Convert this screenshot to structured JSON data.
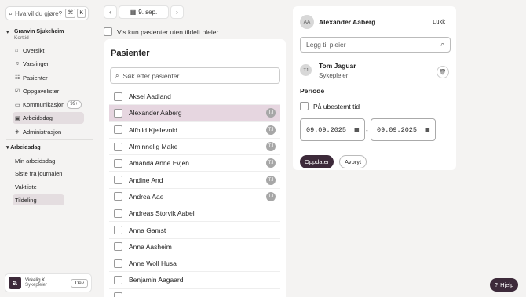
{
  "sidebar": {
    "search": {
      "placeholder": "Hva vil du gjøre?",
      "kbd1": "⌘",
      "kbd2": "K"
    },
    "org": {
      "name": "Granvin Sjukeheim",
      "sub": "Korttid"
    },
    "nav": [
      {
        "icon": "home-icon",
        "glyph": "⌂",
        "label": "Oversikt"
      },
      {
        "icon": "bell-icon",
        "glyph": "♫",
        "label": "Varslinger"
      },
      {
        "icon": "patients-icon",
        "glyph": "☷",
        "label": "Pasienter"
      },
      {
        "icon": "checklist-icon",
        "glyph": "☑",
        "label": "Oppgavelister"
      },
      {
        "icon": "chat-icon",
        "glyph": "▭",
        "label": "Kommunikasjon",
        "badge": "99+"
      },
      {
        "icon": "briefcase-icon",
        "glyph": "▣",
        "label": "Arbeidsdag",
        "active": true
      },
      {
        "icon": "shield-icon",
        "glyph": "◈",
        "label": "Administrasjon"
      }
    ],
    "section": "Arbeidsdag",
    "sub": [
      "Min arbeidsdag",
      "Siste fra journalen",
      "Vaktliste",
      "Tildeling"
    ],
    "user": {
      "initial": "a",
      "name": "Virkelig K.",
      "role": "Sykepleier",
      "env": "Dev"
    }
  },
  "datebar": {
    "date": "9. sep."
  },
  "filter": {
    "label": "Vis kun pasienter uten tildelt pleier"
  },
  "patients": {
    "title": "Pasienter",
    "search_placeholder": "Søk etter pasienter",
    "rows": [
      {
        "name": "Aksel Aadland",
        "tag": ""
      },
      {
        "name": "Alexander Aaberg",
        "tag": "TJ",
        "selected": true
      },
      {
        "name": "Alfhild Kjellevold",
        "tag": "TJ"
      },
      {
        "name": "Alminnelig Make",
        "tag": "TJ"
      },
      {
        "name": "Amanda Anne Evjen",
        "tag": "TJ"
      },
      {
        "name": "Andine And",
        "tag": "TJ"
      },
      {
        "name": "Andrea Aae",
        "tag": "TJ"
      },
      {
        "name": "Andreas Storvik Aabel",
        "tag": ""
      },
      {
        "name": "Anna Gamst",
        "tag": ""
      },
      {
        "name": "Anna Aasheim",
        "tag": ""
      },
      {
        "name": "Anne Woll Husa",
        "tag": ""
      },
      {
        "name": "Benjamin Aagaard",
        "tag": ""
      },
      {
        "name": "",
        "tag": ""
      }
    ]
  },
  "detail": {
    "initials": "AA",
    "name": "Alexander Aaberg",
    "close": "Lukk",
    "add_placeholder": "Legg til pleier",
    "nurse": {
      "initials": "TJ",
      "name": "Tom Jaguar",
      "role": "Sykepleier"
    },
    "period_label": "Periode",
    "unbounded_label": "På ubestemt tid",
    "from": "09.09.2025",
    "dash": "-",
    "to": "09.09.2025",
    "update": "Oppdater",
    "cancel": "Avbryt"
  },
  "help": {
    "label": "Hjelp"
  }
}
